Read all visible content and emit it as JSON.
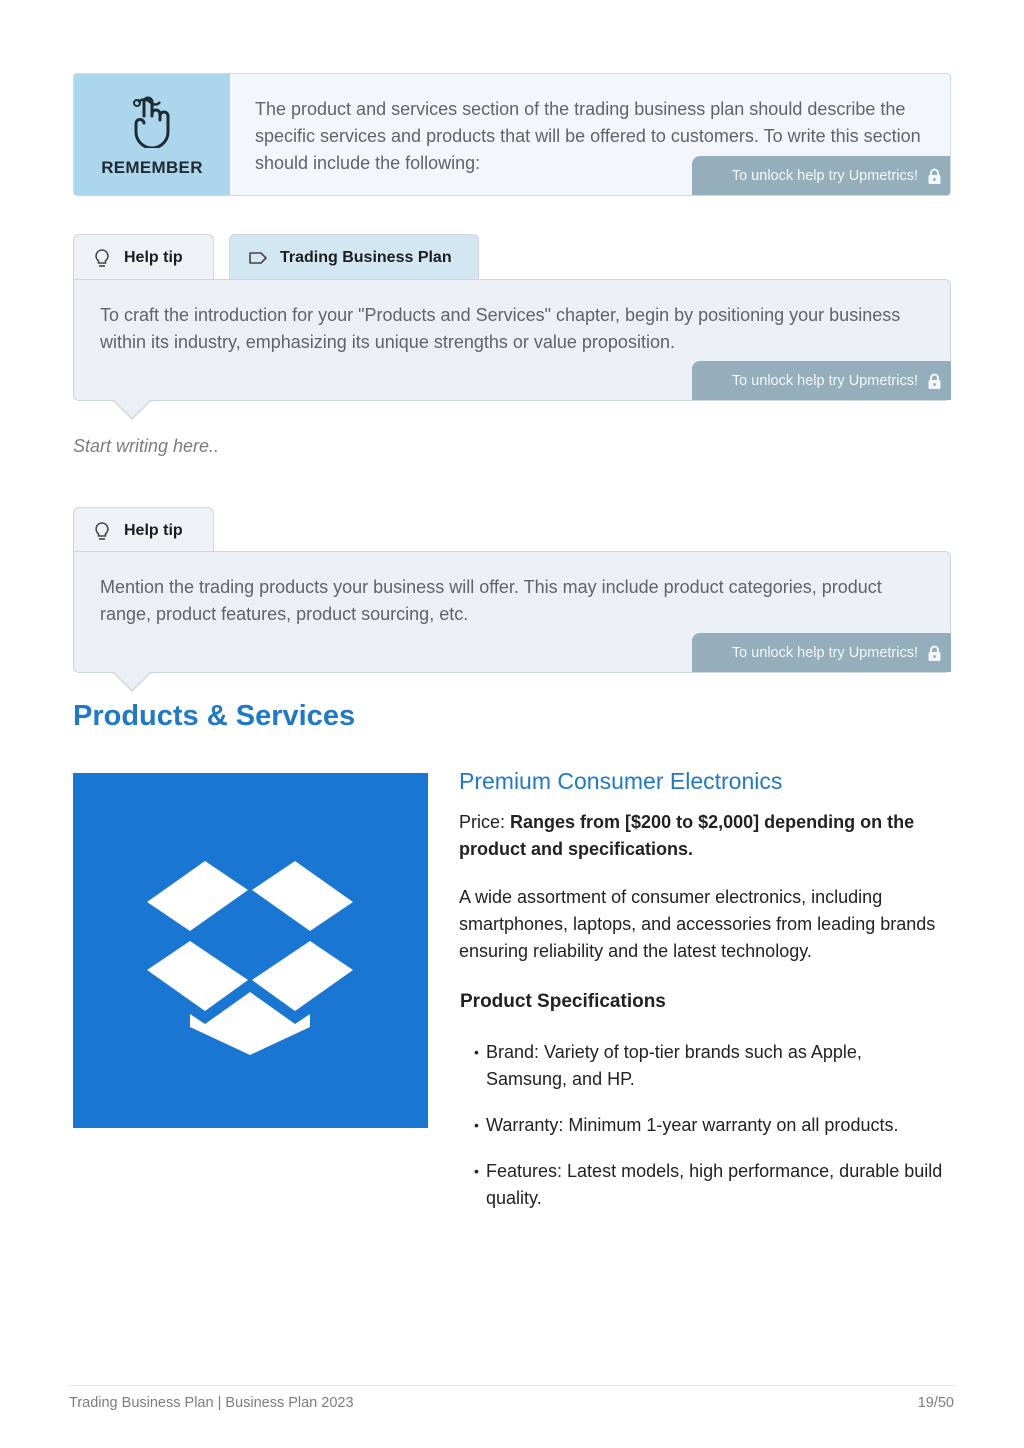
{
  "remember": {
    "label": "REMEMBER",
    "icon": "finger-string-icon",
    "text": "The product and services section of the trading business plan should describe the specific services and products that will be offered to customers. To write this section should include the following:",
    "unlock_label": "To unlock help try Upmetrics!"
  },
  "tip1": {
    "tabs": [
      {
        "label": "Help tip",
        "icon": "lightbulb-icon"
      },
      {
        "label": "Trading Business Plan",
        "icon": "tag-icon"
      }
    ],
    "text": "To craft the introduction for your \"Products and Services\" chapter, begin by positioning your business within its industry, emphasizing its unique strengths or value proposition.",
    "unlock_label": "To unlock help try Upmetrics!"
  },
  "editor": {
    "placeholder": "Start writing here.."
  },
  "tip2": {
    "tabs": [
      {
        "label": "Help tip",
        "icon": "lightbulb-icon"
      }
    ],
    "text": "Mention the trading products your business will offer. This may include product categories, product range, product features, product sourcing, etc.",
    "unlock_label": "To unlock help try Upmetrics!"
  },
  "section": {
    "title": "Products & Services"
  },
  "product": {
    "image_icon": "dropbox-box-icon",
    "title": "Premium Consumer Electronics",
    "price_label": "Price: ",
    "price_value": "Ranges from [$200 to $2,000] depending on the product and specifications.",
    "description": "A wide assortment of consumer electronics, including smartphones, laptops, and accessories from leading brands ensuring reliability and the latest technology.",
    "specs_title": "Product Specifications",
    "specs": [
      "Brand: Variety of top-tier brands such as Apple, Samsung, and HP.",
      "Warranty: Minimum 1-year warranty on all products.",
      "Features: Latest models, high performance, durable build quality."
    ]
  },
  "footer": {
    "left": "Trading Business Plan | Business Plan 2023",
    "page": "19/50"
  },
  "colors": {
    "accent": "#1f78c8",
    "image_bg": "#1976d2",
    "remember_bg": "#acd6ec",
    "unlock_bg": "#94aebc",
    "tip_bg": "#eceff5"
  }
}
